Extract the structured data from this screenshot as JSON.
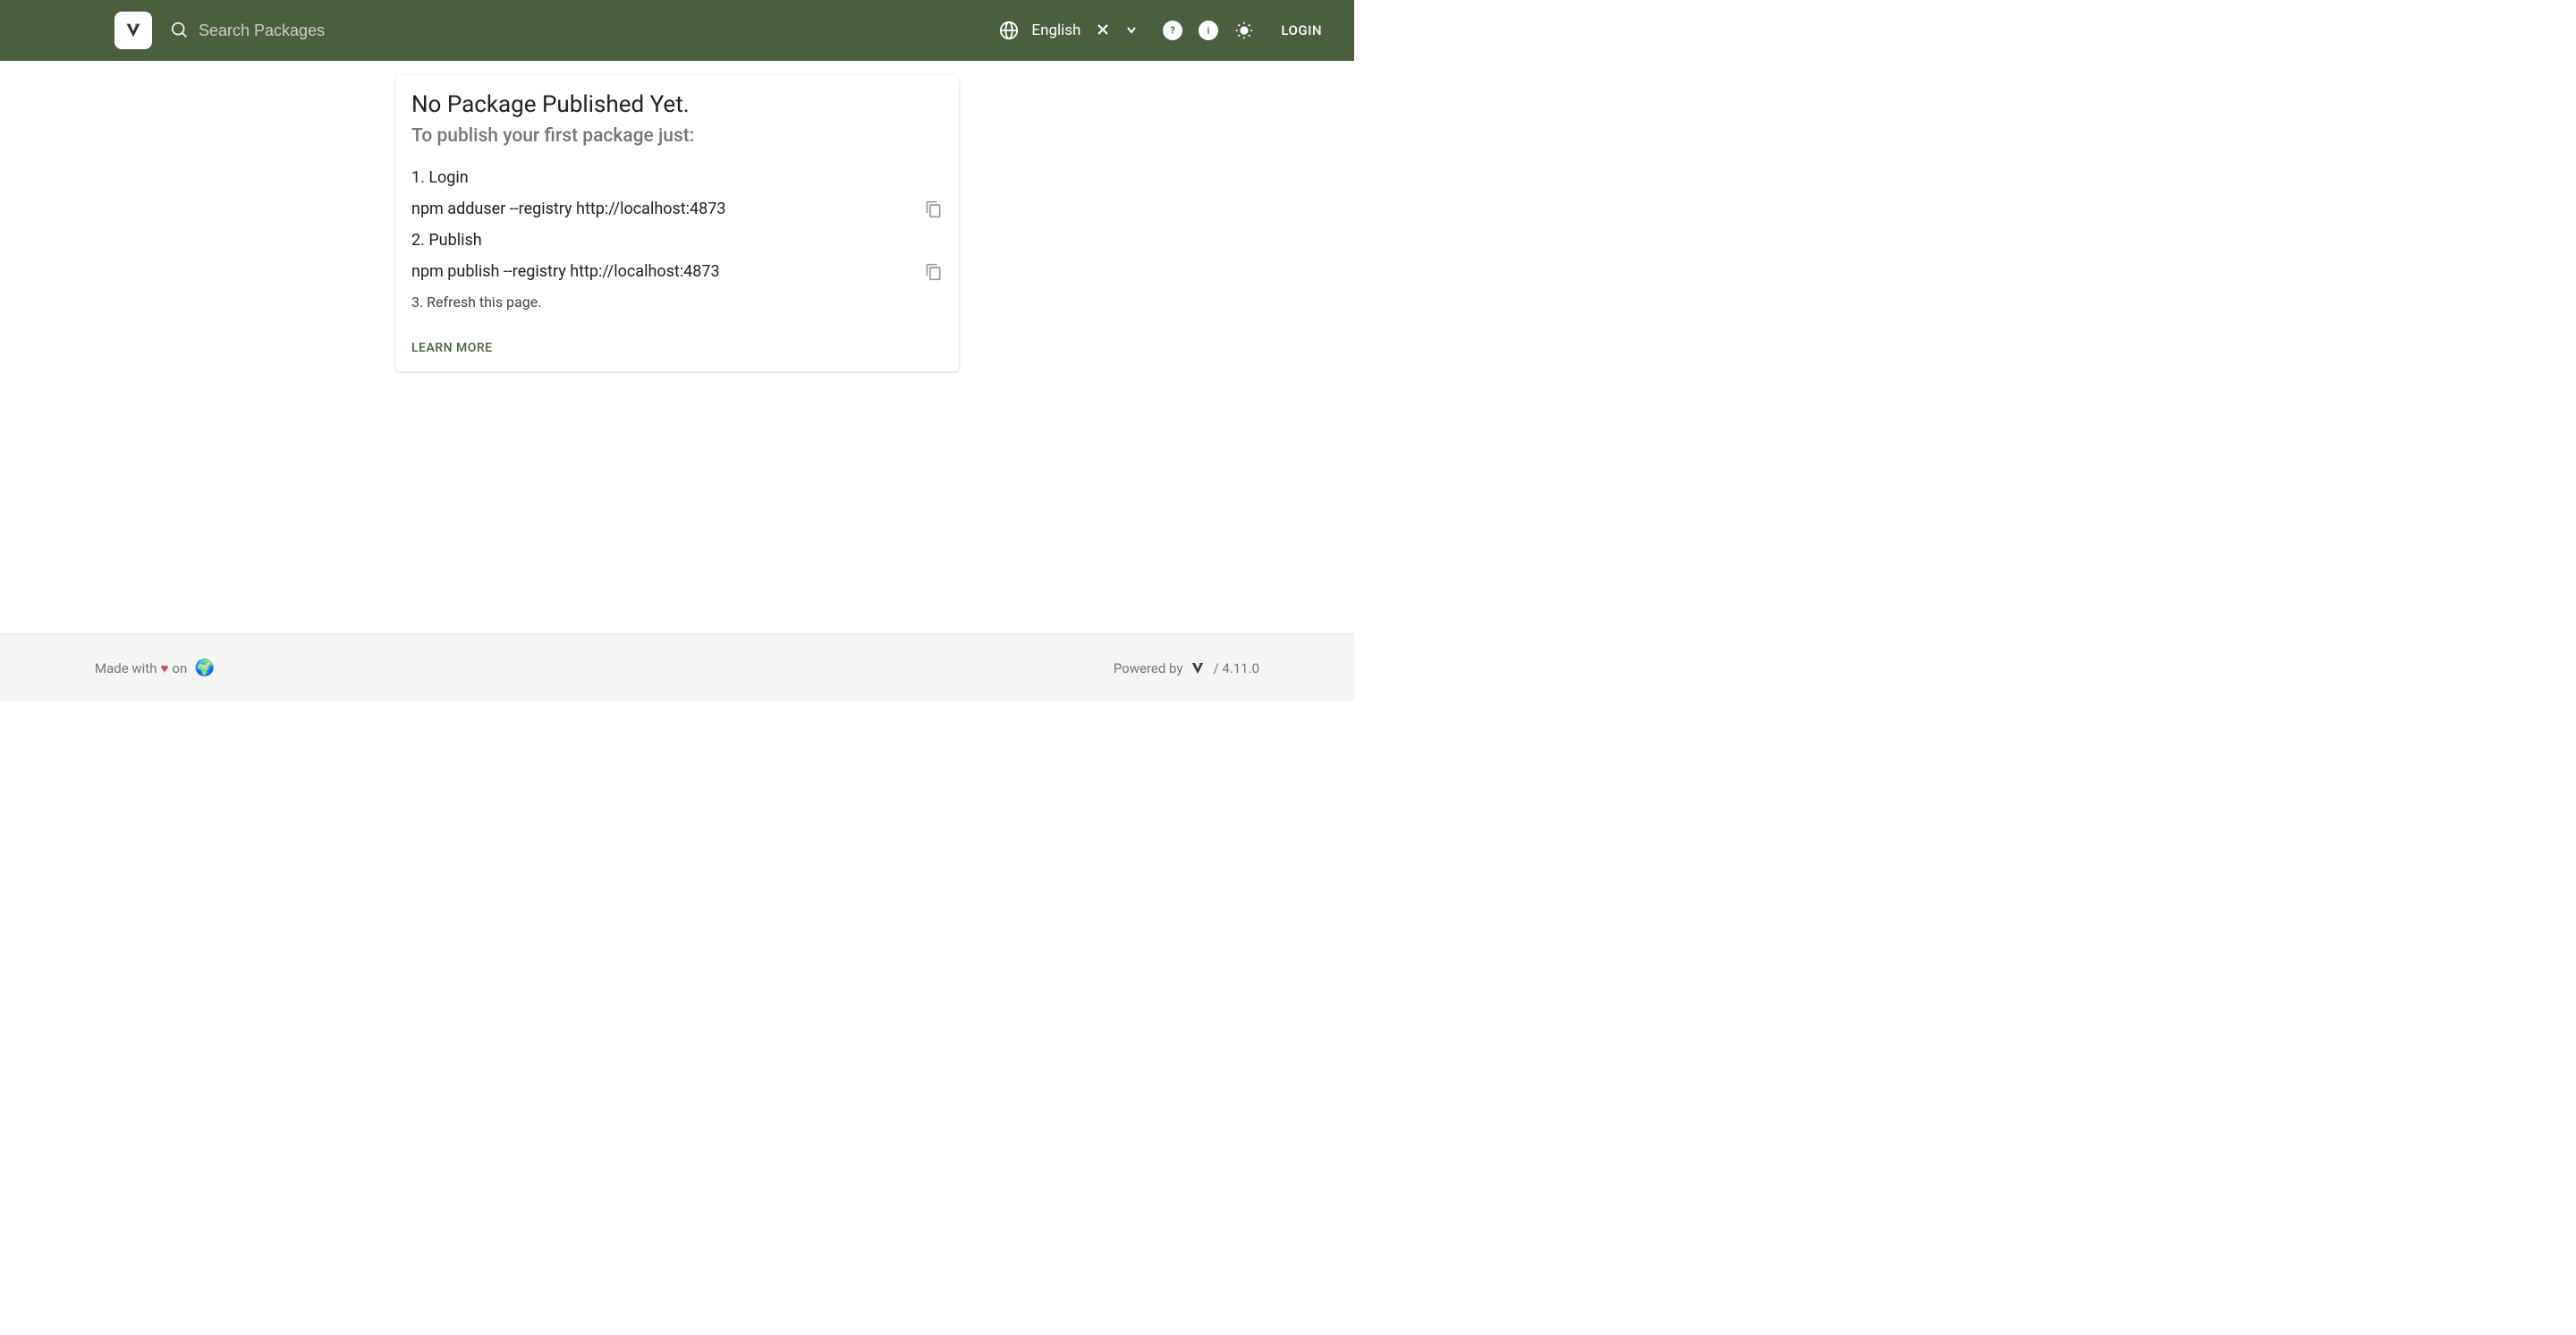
{
  "header": {
    "search_placeholder": "Search Packages",
    "language": "English",
    "login_label": "LOGIN"
  },
  "card": {
    "title": "No Package Published Yet.",
    "subtitle": "To publish your first package just:",
    "step1_label": "1. Login",
    "step1_command": "npm adduser --registry http://localhost:4873",
    "step2_label": "2. Publish",
    "step2_command": "npm publish --registry http://localhost:4873",
    "step3_label": "3. Refresh this page.",
    "learn_more": "LEARN MORE"
  },
  "footer": {
    "made_with": "Made with",
    "on": "on",
    "powered_by": "Powered by",
    "version": "/ 4.11.0"
  }
}
